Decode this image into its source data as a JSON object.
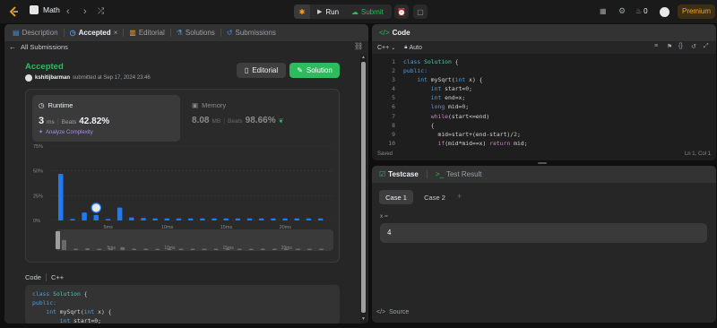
{
  "nav": {
    "title": "Math",
    "run": "Run",
    "submit": "Submit",
    "streak": "0",
    "premium": "Premium"
  },
  "left": {
    "tabs": [
      {
        "label": "Description",
        "icon": "document-icon"
      },
      {
        "label": "Accepted",
        "icon": "clock-icon"
      },
      {
        "label": "Editorial",
        "icon": "book-icon"
      },
      {
        "label": "Solutions",
        "icon": "flask-icon"
      },
      {
        "label": "Submissions",
        "icon": "history-icon"
      }
    ],
    "back_label": "All Submissions",
    "status": "Accepted",
    "user": "kshitijbarman",
    "submitted_text": "submitted at Sep 17, 2024 23:46",
    "editorial_button": "Editorial",
    "solution_button": "Solution",
    "runtime": {
      "label": "Runtime",
      "value": "3",
      "unit": "ms",
      "beats_label": "Beats",
      "beats": "42.82%",
      "analyze": "Analyze Complexity"
    },
    "memory": {
      "label": "Memory",
      "value": "8.08",
      "unit": "MB",
      "beats_label": "Beats",
      "beats": "98.66%"
    },
    "code_label": "Code",
    "code_lang": "C++",
    "code_lines": [
      [
        {
          "t": "class ",
          "c": "kw"
        },
        {
          "t": "Solution",
          "c": "ty"
        },
        {
          "t": " {",
          "c": "tx"
        }
      ],
      [
        {
          "t": "public:",
          "c": "kw"
        }
      ],
      [
        {
          "t": "    ",
          "c": "tx"
        },
        {
          "t": "int",
          "c": "kw"
        },
        {
          "t": " mySqrt(",
          "c": "tx"
        },
        {
          "t": "int",
          "c": "kw"
        },
        {
          "t": " x) {",
          "c": "tx"
        }
      ],
      [
        {
          "t": "        ",
          "c": "tx"
        },
        {
          "t": "int",
          "c": "kw"
        },
        {
          "t": " start=0;",
          "c": "tx"
        }
      ]
    ]
  },
  "chart_data": {
    "type": "bar",
    "ylabel_ticks": [
      "75%",
      "50%",
      "25%",
      "0%"
    ],
    "ylim": [
      0,
      75
    ],
    "xtick_labels": [
      "5ms",
      "10ms",
      "15ms",
      "20ms"
    ],
    "navigator_tick_labels": [
      "5ms",
      "10ms",
      "15ms",
      "20ms"
    ],
    "values": [
      47,
      1.5,
      8,
      5.5,
      1.5,
      13,
      3,
      2.5,
      2,
      2,
      2,
      2,
      2,
      2,
      2,
      2,
      2,
      2,
      2,
      2,
      2,
      2,
      2
    ],
    "highlight_index": 3,
    "bar_color": "#1e7af2"
  },
  "editor": {
    "title": "Code",
    "lang": "C++",
    "mode": "Auto",
    "status_left": "Saved",
    "status_right": "Ln 1, Col 1",
    "lines": [
      [
        {
          "t": "class ",
          "c": "kw"
        },
        {
          "t": "Solution",
          "c": "ty"
        },
        {
          "t": " {",
          "c": "tx"
        }
      ],
      [
        {
          "t": "public:",
          "c": "kw"
        }
      ],
      [
        {
          "t": "    ",
          "c": "tx"
        },
        {
          "t": "int",
          "c": "kw"
        },
        {
          "t": " mySqrt(",
          "c": "tx"
        },
        {
          "t": "int",
          "c": "kw"
        },
        {
          "t": " x) {",
          "c": "tx"
        }
      ],
      [
        {
          "t": "        ",
          "c": "tx"
        },
        {
          "t": "int",
          "c": "kw"
        },
        {
          "t": " start=",
          "c": "tx"
        },
        {
          "t": "0",
          "c": "nm"
        },
        {
          "t": ";",
          "c": "tx"
        }
      ],
      [
        {
          "t": "        ",
          "c": "tx"
        },
        {
          "t": "int",
          "c": "kw"
        },
        {
          "t": " end=x;",
          "c": "tx"
        }
      ],
      [
        {
          "t": "        ",
          "c": "tx"
        },
        {
          "t": "long",
          "c": "kw"
        },
        {
          "t": " mid=",
          "c": "tx"
        },
        {
          "t": "0",
          "c": "nm"
        },
        {
          "t": ";",
          "c": "tx"
        }
      ],
      [
        {
          "t": "        ",
          "c": "tx"
        },
        {
          "t": "while",
          "c": "ctl"
        },
        {
          "t": "(start<=end)",
          "c": "tx"
        }
      ],
      [
        {
          "t": "        {",
          "c": "tx"
        }
      ],
      [
        {
          "t": "          mid=start+(end-start)/",
          "c": "tx"
        },
        {
          "t": "2",
          "c": "nm"
        },
        {
          "t": ";",
          "c": "tx"
        }
      ],
      [
        {
          "t": "          ",
          "c": "tx"
        },
        {
          "t": "if",
          "c": "ctl"
        },
        {
          "t": "(mid*mid==x) ",
          "c": "tx"
        },
        {
          "t": "return",
          "c": "ctl"
        },
        {
          "t": " mid;",
          "c": "tx"
        }
      ]
    ]
  },
  "testcase": {
    "tab": "Testcase",
    "result_tab": "Test Result",
    "cases": [
      "Case 1",
      "Case 2"
    ],
    "add": "+",
    "var_label": "x =",
    "var_value": "4",
    "source": "Source"
  }
}
